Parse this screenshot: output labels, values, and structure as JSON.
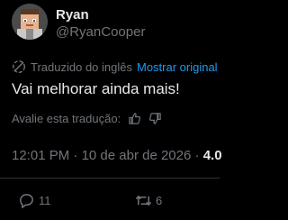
{
  "author": {
    "name": "Ryan",
    "handle": "@RyanCooper"
  },
  "translation": {
    "label": "Traduzido do inglês",
    "show_original": "Mostrar original"
  },
  "tweet": {
    "text": "Vai melhorar ainda mais!"
  },
  "rating": {
    "prompt": "Avalie esta tradução:"
  },
  "meta": {
    "time": "12:01 PM",
    "separator": " · ",
    "date": "10 de abr de 2026",
    "views": "4.0"
  },
  "actions": {
    "reply_count": "11",
    "retweet_count": "6"
  },
  "colors": {
    "background": "#000000",
    "text": "#e7e9ea",
    "muted": "#71767b",
    "link": "#1d9bf0",
    "divider": "#2f3336"
  }
}
